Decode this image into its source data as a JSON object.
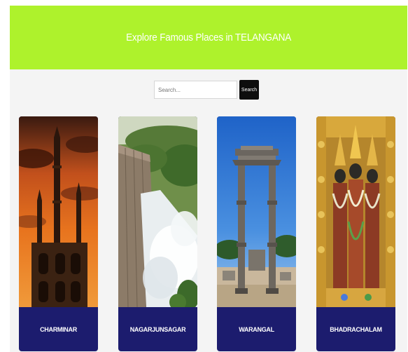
{
  "header": {
    "title": "Explore Famous Places in TELANGANA"
  },
  "search": {
    "placeholder": "Search...",
    "button_label": "Search"
  },
  "places": [
    {
      "name": "CHARMINAR"
    },
    {
      "name": "NAGARJUNSAGAR"
    },
    {
      "name": "WARANGAL"
    },
    {
      "name": "BHADRACHALAM"
    }
  ],
  "colors": {
    "header_background": "#aef22c",
    "card_label_background": "#1c1c6e",
    "page_background": "#f4f4f4",
    "search_button_background": "#0d0d0d"
  }
}
